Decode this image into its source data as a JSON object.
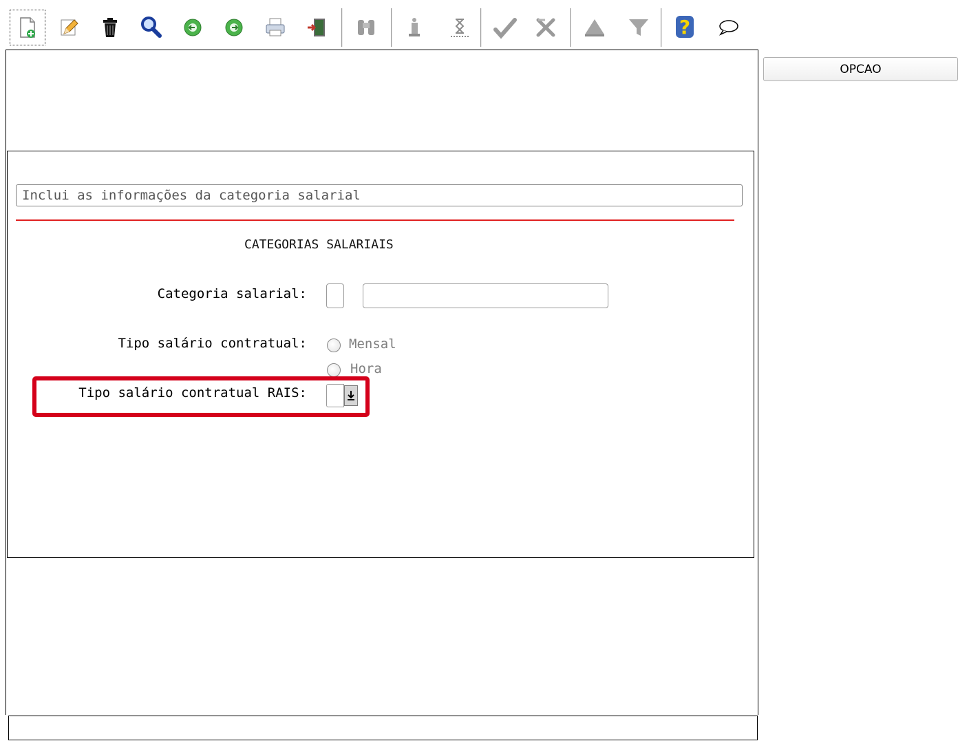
{
  "toolbar": {
    "buttons": [
      {
        "icon": "new-document-icon"
      },
      {
        "icon": "edit-pencil-icon"
      },
      {
        "icon": "trash-icon"
      },
      {
        "icon": "search-magnifier-icon"
      },
      {
        "icon": "previous-green-icon"
      },
      {
        "icon": "next-green-icon"
      },
      {
        "icon": "print-icon"
      },
      {
        "icon": "exit-door-icon"
      },
      {
        "icon": "binoculars-icon"
      },
      {
        "icon": "info-icon"
      },
      {
        "icon": "hourglass-icon"
      },
      {
        "icon": "confirm-check-icon"
      },
      {
        "icon": "cancel-icon"
      },
      {
        "icon": "triangle-up-icon"
      },
      {
        "icon": "funnel-icon"
      },
      {
        "icon": "help-question-icon"
      },
      {
        "icon": "speech-bubble-icon"
      }
    ]
  },
  "side": {
    "opcao_label": "OPCAO"
  },
  "form": {
    "hint": "Inclui as informações da categoria salarial",
    "section_title": "CATEGORIAS SALARIAIS",
    "categoria_label": "Categoria salarial:",
    "tipo_salario_label": "Tipo salário contratual:",
    "radio_mensal": "Mensal",
    "radio_hora": "Hora",
    "tipo_rais_label": "Tipo salário contratual RAIS:"
  },
  "colors": {
    "highlight": "#d4001a",
    "rule": "#e02020"
  }
}
